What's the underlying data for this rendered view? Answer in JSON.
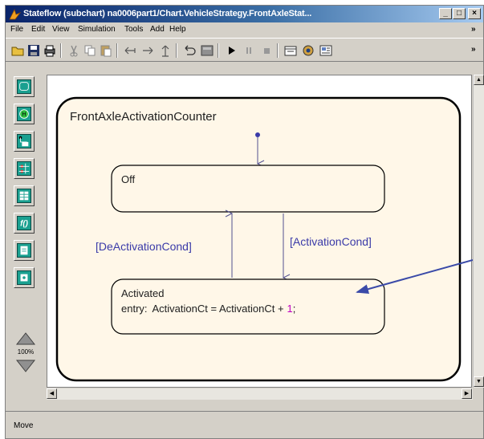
{
  "window": {
    "title": "Stateflow (subchart) na0006part1/Chart.VehicleStrategy.FrontAxleStat...",
    "controls": [
      "_",
      "□",
      "×"
    ]
  },
  "menubar": {
    "items": [
      {
        "label": "File"
      },
      {
        "label": "Edit"
      },
      {
        "label": "View"
      },
      {
        "label": "Simulation"
      },
      {
        "label": "Tools"
      },
      {
        "label": "Add"
      },
      {
        "label": "Help"
      }
    ],
    "overflow": "»"
  },
  "toolbar": {
    "icons": [
      "open-folder-icon",
      "save-icon",
      "print-icon",
      "cut-icon",
      "copy-icon",
      "paste-icon",
      "move-left-icon",
      "move-right-icon",
      "move-up-icon",
      "undo-icon",
      "model-explorer-icon",
      "play-icon",
      "pause-icon",
      "stop-icon",
      "debug-icon",
      "target-icon",
      "explorer-icon"
    ],
    "overflow": "»"
  },
  "palette": {
    "tools": [
      "state-tool-icon",
      "history-junction-icon",
      "default-transition-icon",
      "connective-junction-icon",
      "truth-table-icon",
      "graphical-function-icon",
      "embedded-function-icon",
      "box-tool-icon"
    ],
    "zoom_label": "100%"
  },
  "chart": {
    "superstate_name": "FrontAxleActivationCounter",
    "state_off": {
      "name": "Off"
    },
    "state_activated": {
      "name": "Activated",
      "action_prefix": "entry:",
      "action_expr": "ActivationCt = ActivationCt +",
      "action_value": "1",
      "action_end": ";"
    },
    "transition_up_label": "[DeActivationCond]",
    "transition_down_label": "[ActivationCond]",
    "colors": {
      "state_fill": "#fff7e8",
      "state_stroke": "#000000",
      "label_color": "#3a3aa8",
      "annotation_arrow": "#3a4aa8",
      "value_color": "#c000c0"
    }
  },
  "statusbar": {
    "text": "Move"
  }
}
